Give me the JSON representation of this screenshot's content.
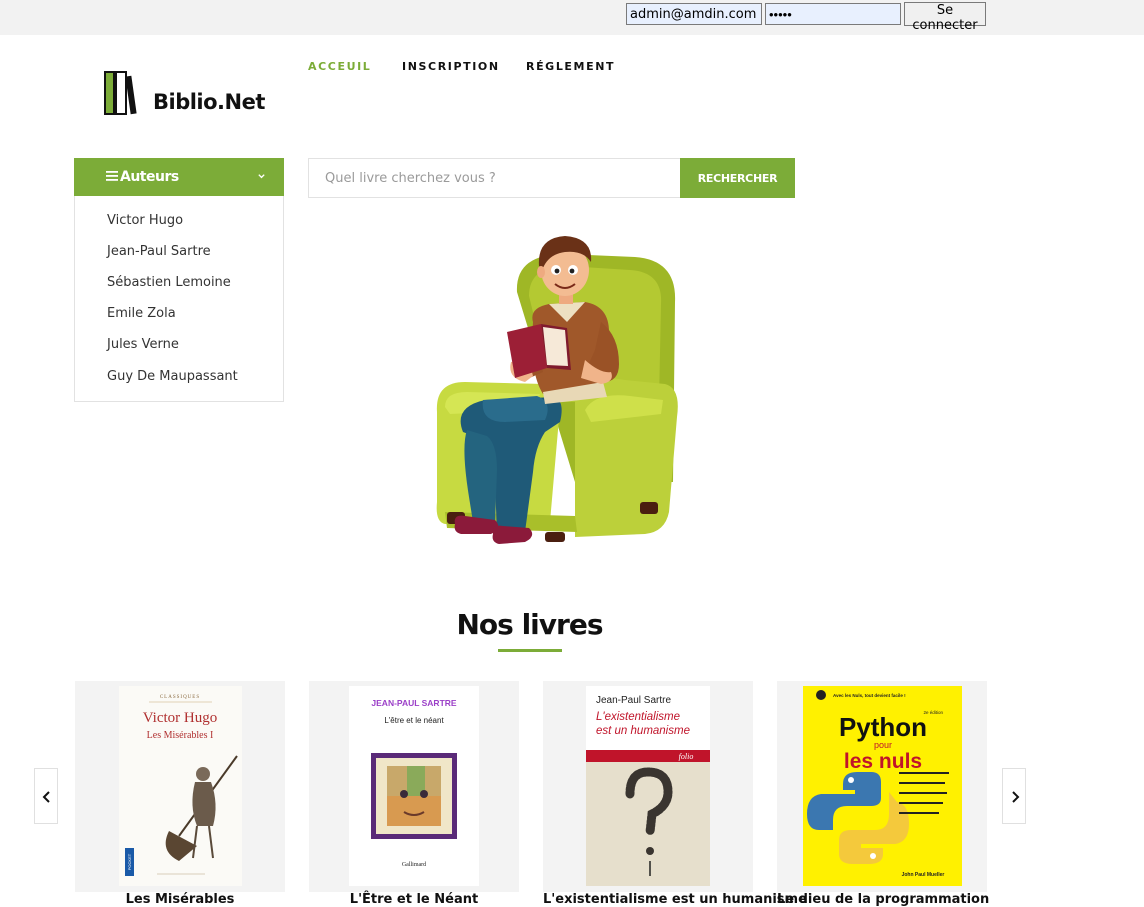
{
  "login": {
    "email_value": "admin@amdin.com",
    "password_value": "•••••",
    "submit_label": "Se connecter"
  },
  "brand": {
    "name": "Biblio.Net"
  },
  "nav": {
    "items": [
      {
        "label": "ACCEUIL"
      },
      {
        "label": "INSCRIPTION"
      },
      {
        "label": "RÉGLEMENT"
      }
    ]
  },
  "authors": {
    "title": "Auteurs",
    "items": [
      "Victor Hugo",
      "Jean-Paul Sartre",
      "Sébastien Lemoine",
      "Emile Zola",
      "Jules Verne",
      "Guy De Maupassant"
    ]
  },
  "search": {
    "placeholder": "Quel livre cherchez vous ?",
    "button_label": "RECHERCHER"
  },
  "books": {
    "title": "Nos livres",
    "items": [
      {
        "title": "Les Misérables",
        "cover": {
          "series": "CLASSIQUES",
          "author": "Victor Hugo",
          "book_title": "Les Misérables I",
          "publisher": "POCKET"
        }
      },
      {
        "title": "L'Être et le Néant",
        "cover": {
          "author": "JEAN-PAUL SARTRE",
          "book_title": "L'être et le néant",
          "publisher": "Gallimard"
        }
      },
      {
        "title": "L'existentialisme est un humanisme",
        "cover": {
          "author": "Jean-Paul Sartre",
          "book_title_1": "L'existentialisme",
          "book_title_2": "est un humanisme",
          "publisher": "folio"
        }
      },
      {
        "title": "Le dieu de la programmation",
        "cover": {
          "tagline": "Avec les Nuls, tout devient facile !",
          "edition": "2e édition",
          "title_1": "Python",
          "title_2": "pour",
          "title_3": "les nuls",
          "author": "John Paul Mueller"
        }
      }
    ]
  },
  "colors": {
    "accent": "#7cac38"
  },
  "icons": [
    "menu-icon",
    "chevron-down-icon",
    "chevron-left-icon",
    "chevron-right-icon"
  ]
}
